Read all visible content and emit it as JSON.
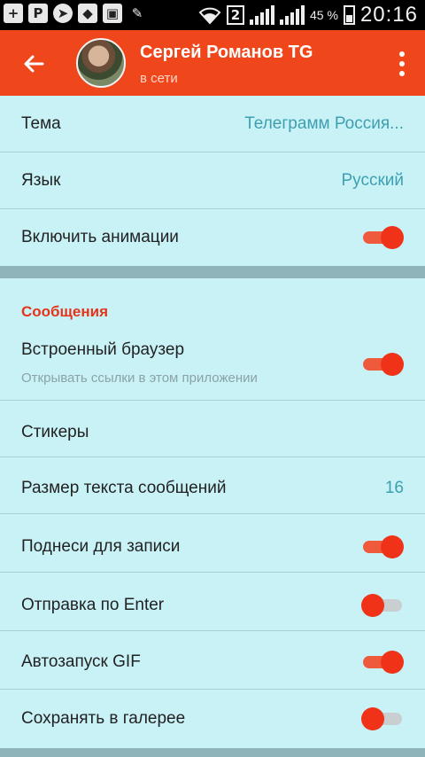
{
  "status_bar": {
    "left_icons": [
      "plus-icon",
      "p-icon",
      "telegram-icon",
      "shield-icon",
      "image-icon",
      "wrench-icon"
    ],
    "sim_number": "2",
    "battery_percent": "45 %",
    "time": "20:16"
  },
  "appbar": {
    "title": "Сергей Романов TG",
    "subtitle": "в сети",
    "color": "#f0461c"
  },
  "settings": {
    "theme_label": "Тема",
    "theme_value": "Телеграмм Россия...",
    "language_label": "Язык",
    "language_value": "Русский",
    "animations_label": "Включить анимации",
    "animations_on": true
  },
  "messages": {
    "header": "Сообщения",
    "browser_label": "Встроенный браузер",
    "browser_hint": "Открывать ссылки в этом приложении",
    "browser_on": true,
    "stickers_label": "Стикеры",
    "text_size_label": "Размер текста сообщений",
    "text_size_value": "16",
    "raise_label": "Поднеси для записи",
    "raise_on": true,
    "enter_label": "Отправка по Enter",
    "enter_on": false,
    "gif_label": "Автозапуск GIF",
    "gif_on": true,
    "gallery_label": "Сохранять в галерее",
    "gallery_on": false
  },
  "colors": {
    "accent": "#f03218",
    "background": "#c9f2f7",
    "value_text": "#3e9fb0"
  }
}
